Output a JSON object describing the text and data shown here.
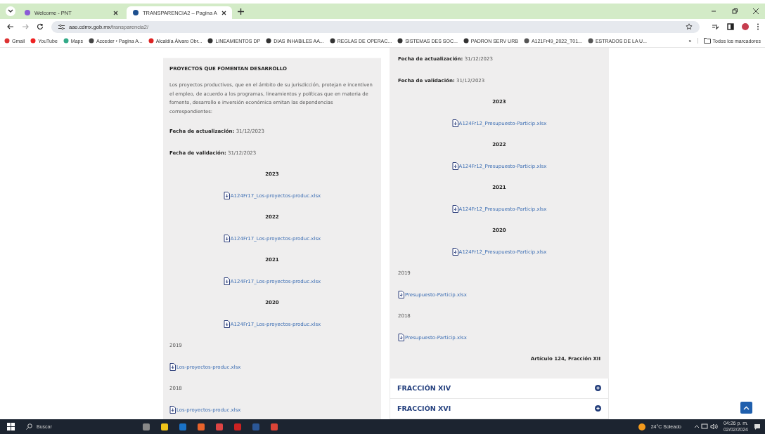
{
  "browser": {
    "tabs": [
      {
        "title": "Welcome - PNT",
        "selected": false
      },
      {
        "title": "TRANSPARENCIA2 – Pagina A",
        "selected": true
      }
    ],
    "address": {
      "domain": "aao.cdmx.gob.mx",
      "path": "/transparencia2/"
    },
    "bookmarks": [
      "Gmail",
      "YouTube",
      "Maps",
      "Acceder ‹ Pagina A...",
      "Alcaldía Álvaro Obr...",
      "LINEAMIENTOS DP",
      "DIAS INHABILES AA...",
      "REGLAS DE OPERAC...",
      "SISTEMAS DES SOC...",
      "PADRON SERV URB",
      "A121Fr49_2022_T01...",
      "ESTRADOS DE LA U..."
    ],
    "more": "»",
    "all_bookmarks": "Todos los marcadores"
  },
  "left": {
    "heading": "PROYECTOS QUE FOMENTAN DESARROLLO",
    "description": "Los proyectos productivos, que en el ámbito de su jurisdicción, protejan e incentiven el empleo, de acuerdo a los programas, lineamientos y políticas que en materia de fomento, desarrollo e inversión económica emitan las dependencias correspondientes:",
    "dates": [
      {
        "label": "Fecha de actualización:",
        "value": "31/12/2023"
      },
      {
        "label": "Fecha de validación:",
        "value": "31/12/2023"
      }
    ],
    "years": [
      {
        "kind": "centered",
        "year": "2023",
        "file": "A124Fr17_Los-proyectos-produc.xlsx"
      },
      {
        "kind": "centered",
        "year": "2022",
        "file": "A124Fr17_Los-proyectos-produc.xlsx"
      },
      {
        "kind": "centered",
        "year": "2021",
        "file": "A124Fr17_Los-proyectos-produc.xlsx"
      },
      {
        "kind": "centered",
        "year": "2020",
        "file": "A124Fr17_Los-proyectos-produc.xlsx"
      },
      {
        "kind": "plain",
        "year": "2019",
        "file": "Los-proyectos-produc.xlsx"
      },
      {
        "kind": "plain",
        "year": "2018",
        "file": "Los-proyectos-produc.xlsx"
      }
    ]
  },
  "right": {
    "dates": [
      {
        "label": "Fecha de actualización:",
        "value": "31/12/2023"
      },
      {
        "label": "Fecha de validación:",
        "value": "31/12/2023"
      }
    ],
    "years": [
      {
        "kind": "centered",
        "year": "2023",
        "file": "A124Fr12_Presupuesto-Particip.xlsx"
      },
      {
        "kind": "centered",
        "year": "2022",
        "file": "A124Fr12_Presupuesto-Particip.xlsx"
      },
      {
        "kind": "centered",
        "year": "2021",
        "file": "A124Fr12_Presupuesto-Particip.xlsx"
      },
      {
        "kind": "centered",
        "year": "2020",
        "file": "A124Fr12_Presupuesto-Particip.xlsx"
      },
      {
        "kind": "plain",
        "year": "2019",
        "file": "Presupuesto-Particip.xlsx"
      },
      {
        "kind": "plain",
        "year": "2018",
        "file": "Presupuesto-Particip.xlsx"
      }
    ],
    "footer": "Artículo 124, Fracción XII",
    "accordion": [
      {
        "title": "FRACCIÓN XIV",
        "expanded": false
      },
      {
        "title": "FRACCIÓN XVI",
        "expanded": false
      }
    ]
  },
  "taskbar": {
    "search_placeholder": "Buscar",
    "weather": "24°C Soleado",
    "time": "04:26 p. m.",
    "date": "02/02/2024"
  }
}
